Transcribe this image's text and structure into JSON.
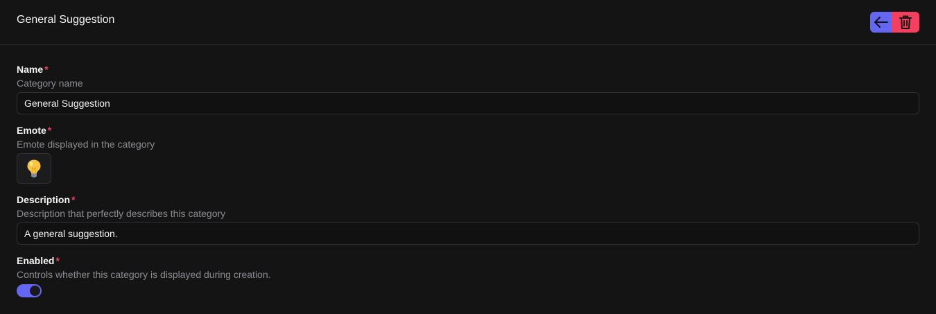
{
  "header": {
    "title": "General Suggestion",
    "back_icon": "arrow-left-icon",
    "delete_icon": "trash-icon",
    "back_color": "#6467f2",
    "delete_color": "#f43f5e"
  },
  "form": {
    "name": {
      "label": "Name",
      "required": "*",
      "description": "Category name",
      "value": "General Suggestion"
    },
    "emote": {
      "label": "Emote",
      "required": "*",
      "description": "Emote displayed in the category",
      "value": "💡"
    },
    "description": {
      "label": "Description",
      "required": "*",
      "description": "Description that perfectly describes this category",
      "value": "A general suggestion."
    },
    "enabled": {
      "label": "Enabled",
      "required": "*",
      "description": "Controls whether this category is displayed during creation.",
      "checked": true
    }
  },
  "colors": {
    "background": "#141415",
    "accent": "#6467f2",
    "danger": "#f43f5e"
  }
}
